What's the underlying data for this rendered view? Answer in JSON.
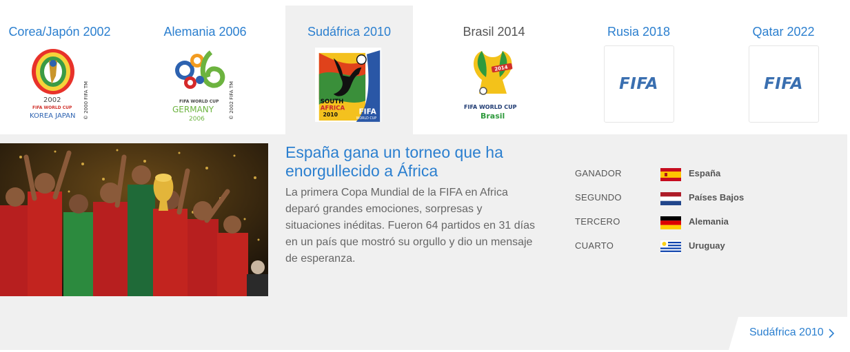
{
  "tabs": [
    {
      "title": "Corea/Japón 2002"
    },
    {
      "title": "Alemania 2006"
    },
    {
      "title": "Sudáfrica 2010"
    },
    {
      "title": "Brasil 2014"
    },
    {
      "title": "Rusia 2018"
    },
    {
      "title": "Qatar 2022"
    }
  ],
  "active_tab_index": 2,
  "emblems": {
    "korea_japan": {
      "year": "2002",
      "line1": "FIFA WORLD CUP",
      "line2": "KOREA JAPAN",
      "side": "© 2000 FIFA TM",
      "icon": "korea-japan-2002-emblem-icon"
    },
    "germany": {
      "line1": "FIFA WORLD CUP",
      "line2": "GERMANY",
      "line3": "2006",
      "side": "© 2002 FIFA TM",
      "icon": "germany-2006-emblem-icon"
    },
    "south_africa": {
      "line1": "SOUTH",
      "line2": "AFRICA",
      "line3": "2010",
      "badge": "FIFA",
      "badge_sub": "WORLD CUP",
      "icon": "south-africa-2010-emblem-icon"
    },
    "brasil": {
      "line1": "FIFA WORLD CUP",
      "line2": "Brasil",
      "ribbon": "2014",
      "icon": "brasil-2014-emblem-icon"
    },
    "russia": {
      "text": "FIFA",
      "icon": "fifa-logo-icon"
    },
    "qatar": {
      "text": "FIFA",
      "icon": "fifa-logo-icon"
    }
  },
  "article": {
    "headline": "España gana un torneo que ha enorgullecido a África",
    "summary": "La primera Copa Mundial de la FIFA en Africa deparó grandes emociones, sorpresas y situaciones inéditas. Fueron 64 partidos en 31 días en un país que mostró su orgullo y dio un mensaje de esperanza.",
    "photo_icon": "spain-team-celebration-photo"
  },
  "results": [
    {
      "label": "GANADOR",
      "team": "España",
      "flag": "spain-flag-icon"
    },
    {
      "label": "SEGUNDO",
      "team": "Países Bajos",
      "flag": "netherlands-flag-icon"
    },
    {
      "label": "TERCERO",
      "team": "Alemania",
      "flag": "germany-flag-icon"
    },
    {
      "label": "CUARTO",
      "team": "Uruguay",
      "flag": "uruguay-flag-icon"
    }
  ],
  "more_link": {
    "label": "Sudáfrica 2010",
    "icon": "chevron-right-icon"
  },
  "colors": {
    "accent": "#2b7fcf",
    "panel_bg": "#f0f0f0",
    "text": "#555555",
    "body_text": "#666666"
  }
}
